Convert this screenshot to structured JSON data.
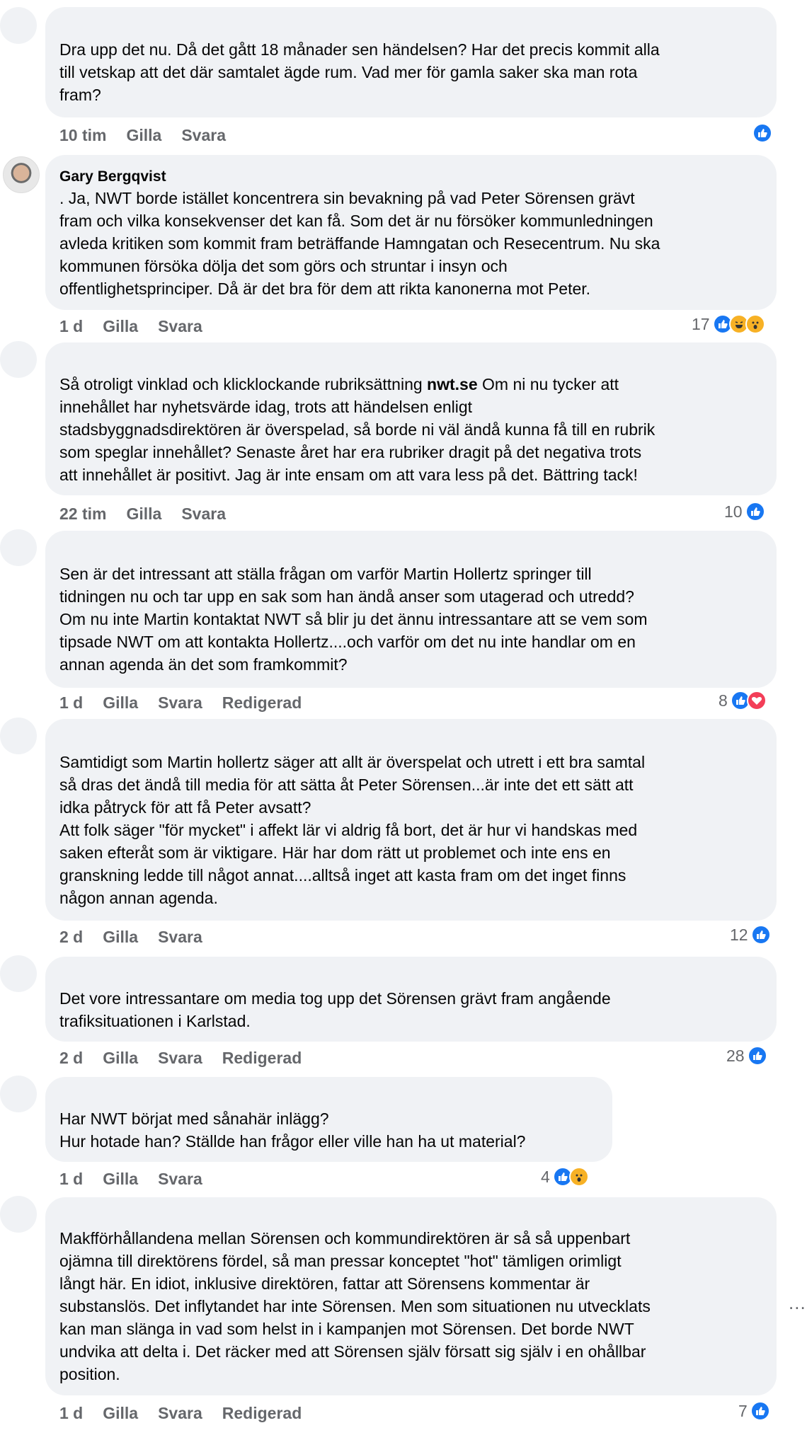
{
  "comments": [
    {
      "author": "",
      "text": "Dra upp det nu. Då det gått 18 månader sen händelsen? Har det precis kommit alla\ntill vetskap att det där samtalet ägde rum. Vad mer för gamla saker ska man rota\nfram?",
      "time": "10 tim",
      "like": "Gilla",
      "reply": "Svara",
      "edited": "",
      "reaction_count": "",
      "reactions": [
        "like"
      ]
    },
    {
      "author": "Gary Bergqvist",
      "text": ". Ja, NWT borde istället koncentrera sin bevakning på vad Peter Sörensen grävt\nfram och vilka konsekvenser det kan få. Som det är nu försöker kommunledningen\navleda kritiken som kommit fram beträffande Hamngatan och Resecentrum. Nu ska\nkommunen försöka dölja det som görs och struntar i insyn och\noffentlighetsprinciper. Då är det bra för dem att rikta kanonerna mot Peter.",
      "time": "1 d",
      "like": "Gilla",
      "reply": "Svara",
      "edited": "",
      "reaction_count": "17",
      "reactions": [
        "like",
        "haha",
        "wow"
      ]
    },
    {
      "author": "",
      "text_before": "Så otroligt vinklad och klicklockande rubriksättning ",
      "text_mention": "nwt.se",
      "text_after": " Om ni nu tycker att\ninnehållet har nyhetsvärde idag, trots att händelsen enligt\nstadsbyggnadsdirektören är överspelad, så borde ni väl ändå kunna få till en rubrik\nsom speglar innehållet? Senaste året har era rubriker dragit på det negativa trots\natt innehållet är positivt. Jag är inte ensam om att vara less på det. Bättring tack!",
      "time": "22 tim",
      "like": "Gilla",
      "reply": "Svara",
      "edited": "",
      "reaction_count": "10",
      "reactions": [
        "like"
      ]
    },
    {
      "author": "",
      "text": "Sen är det intressant att ställa frågan om varför Martin Hollertz springer till\ntidningen nu och tar upp en sak som han ändå anser som utagerad och utredd?\nOm nu inte Martin kontaktat NWT så blir ju det ännu intressantare att se vem som\ntipsade NWT om att kontakta Hollertz....och varför om det nu inte handlar om en\nannan agenda än det som framkommit?",
      "time": "1 d",
      "like": "Gilla",
      "reply": "Svara",
      "edited": "Redigerad",
      "reaction_count": "8",
      "reactions": [
        "like",
        "love"
      ]
    },
    {
      "author": "",
      "text": "Samtidigt som Martin hollertz säger att allt är överspelat och utrett i ett bra samtal\nså dras det ändå till media för att sätta åt Peter Sörensen...är inte det ett sätt att\nidka påtryck för att få Peter avsatt?\nAtt folk säger \"för mycket\" i affekt lär vi aldrig få bort, det är hur vi handskas med\nsaken efteråt som är viktigare. Här har dom rätt ut problemet och inte ens en\ngranskning ledde till något annat....alltså inget att kasta fram om det inget finns\nnågon annan agenda.",
      "time": "2 d",
      "like": "Gilla",
      "reply": "Svara",
      "edited": "",
      "reaction_count": "12",
      "reactions": [
        "like"
      ]
    },
    {
      "author": "",
      "text": "Det vore intressantare om media tog upp det Sörensen grävt fram angående\ntrafiksituationen i Karlstad.",
      "time": "2 d",
      "like": "Gilla",
      "reply": "Svara",
      "edited": "Redigerad",
      "reaction_count": "28",
      "reactions": [
        "like"
      ]
    },
    {
      "author": "",
      "text": "Har NWT börjat med sånahär inlägg?\nHur hotade han? Ställde han frågor eller ville han ha ut material?",
      "time": "1 d",
      "like": "Gilla",
      "reply": "Svara",
      "edited": "",
      "reaction_count": "4",
      "reactions": [
        "like",
        "wow"
      ]
    },
    {
      "author": "",
      "text": "Makfförhållandena mellan Sörensen och kommundirektören är så så uppenbart\nojämna till direktörens fördel, så man pressar konceptet \"hot\" tämligen orimligt\nlångt här. En idiot, inklusive direktören, fattar att Sörensens kommentar är\nsubstanslös. Det inflytandet har inte Sörensen. Men som situationen nu utvecklats\nkan man slänga in vad som helst in i kampanjen mot Sörensen. Det borde NWT\nundvika att delta i. Det räcker med att Sörensen själv försatt sig själv i en ohållbar\nposition.",
      "time": "1 d",
      "like": "Gilla",
      "reply": "Svara",
      "edited": "Redigerad",
      "reaction_count": "7",
      "reactions": [
        "like"
      ]
    }
  ],
  "more_label": "...",
  "colors": {
    "bubble": "#f0f2f5",
    "meta": "#65676b",
    "like": "#1877f2",
    "love": "#f33e58",
    "emoji": "#f7b125"
  }
}
